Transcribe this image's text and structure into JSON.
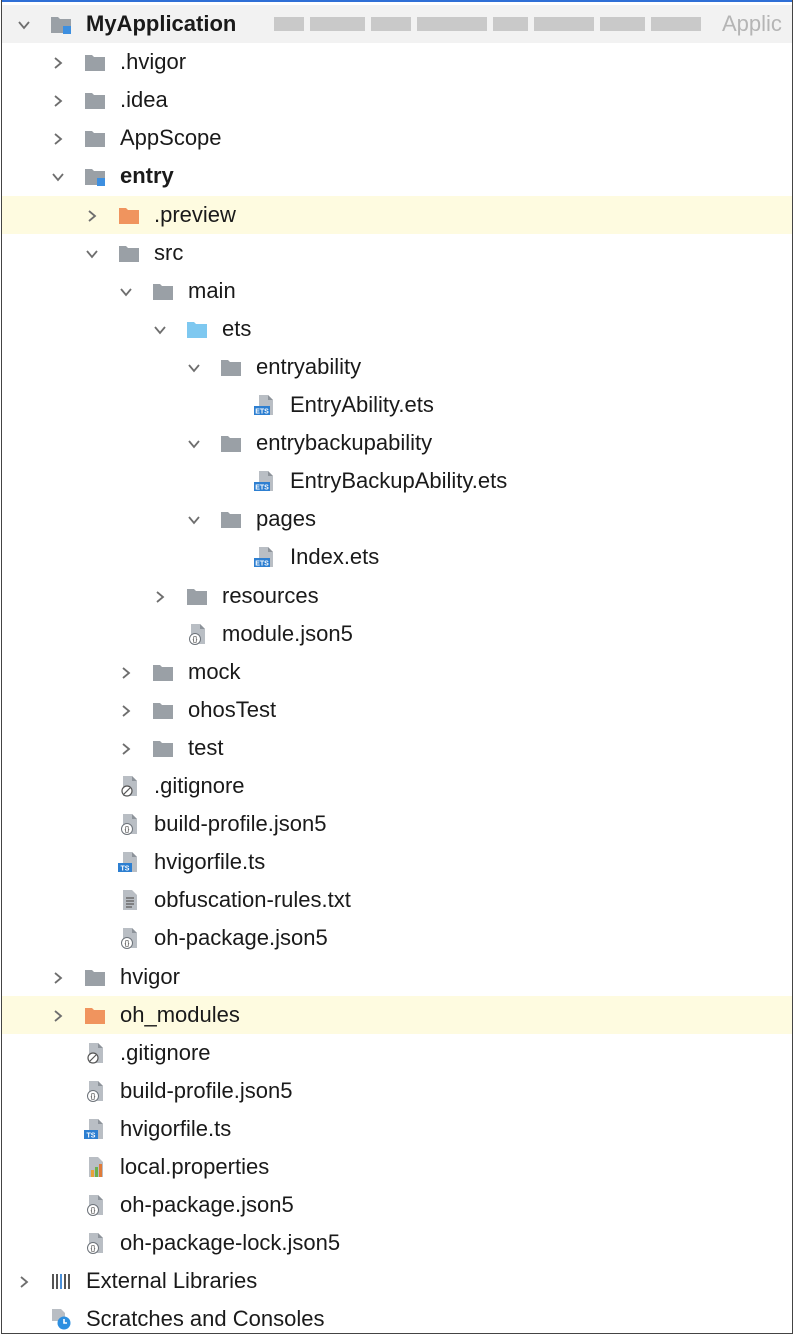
{
  "rows": [
    {
      "label": "MyApplication",
      "depth": 0,
      "chevron": "down",
      "icon": "module-folder",
      "bold": true,
      "root": true,
      "suffix": "Applic"
    },
    {
      "label": ".hvigor",
      "depth": 1,
      "chevron": "right",
      "icon": "folder"
    },
    {
      "label": ".idea",
      "depth": 1,
      "chevron": "right",
      "icon": "folder"
    },
    {
      "label": "AppScope",
      "depth": 1,
      "chevron": "right",
      "icon": "folder"
    },
    {
      "label": "entry",
      "depth": 1,
      "chevron": "down",
      "icon": "module-folder",
      "bold": true
    },
    {
      "label": ".preview",
      "depth": 2,
      "chevron": "right",
      "icon": "folder-orange",
      "highlight": true
    },
    {
      "label": "src",
      "depth": 2,
      "chevron": "down",
      "icon": "folder"
    },
    {
      "label": "main",
      "depth": 3,
      "chevron": "down",
      "icon": "folder"
    },
    {
      "label": "ets",
      "depth": 4,
      "chevron": "down",
      "icon": "folder-blue"
    },
    {
      "label": "entryability",
      "depth": 5,
      "chevron": "down",
      "icon": "folder"
    },
    {
      "label": "EntryAbility.ets",
      "depth": 6,
      "chevron": "none",
      "icon": "ets-file"
    },
    {
      "label": "entrybackupability",
      "depth": 5,
      "chevron": "down",
      "icon": "folder"
    },
    {
      "label": "EntryBackupAbility.ets",
      "depth": 6,
      "chevron": "none",
      "icon": "ets-file"
    },
    {
      "label": "pages",
      "depth": 5,
      "chevron": "down",
      "icon": "folder"
    },
    {
      "label": "Index.ets",
      "depth": 6,
      "chevron": "none",
      "icon": "ets-file"
    },
    {
      "label": "resources",
      "depth": 4,
      "chevron": "right",
      "icon": "folder"
    },
    {
      "label": "module.json5",
      "depth": 4,
      "chevron": "none",
      "icon": "json-file"
    },
    {
      "label": "mock",
      "depth": 3,
      "chevron": "right",
      "icon": "folder"
    },
    {
      "label": "ohosTest",
      "depth": 3,
      "chevron": "right",
      "icon": "folder"
    },
    {
      "label": "test",
      "depth": 3,
      "chevron": "right",
      "icon": "folder"
    },
    {
      "label": ".gitignore",
      "depth": 2,
      "chevron": "none",
      "icon": "ignore-file"
    },
    {
      "label": "build-profile.json5",
      "depth": 2,
      "chevron": "none",
      "icon": "json-file"
    },
    {
      "label": "hvigorfile.ts",
      "depth": 2,
      "chevron": "none",
      "icon": "ts-file"
    },
    {
      "label": "obfuscation-rules.txt",
      "depth": 2,
      "chevron": "none",
      "icon": "text-file"
    },
    {
      "label": "oh-package.json5",
      "depth": 2,
      "chevron": "none",
      "icon": "json-file"
    },
    {
      "label": "hvigor",
      "depth": 1,
      "chevron": "right",
      "icon": "folder"
    },
    {
      "label": "oh_modules",
      "depth": 1,
      "chevron": "right",
      "icon": "folder-orange",
      "highlight": true
    },
    {
      "label": ".gitignore",
      "depth": 1,
      "chevron": "none",
      "icon": "ignore-file"
    },
    {
      "label": "build-profile.json5",
      "depth": 1,
      "chevron": "none",
      "icon": "json-file"
    },
    {
      "label": "hvigorfile.ts",
      "depth": 1,
      "chevron": "none",
      "icon": "ts-file"
    },
    {
      "label": "local.properties",
      "depth": 1,
      "chevron": "none",
      "icon": "properties-file"
    },
    {
      "label": "oh-package.json5",
      "depth": 1,
      "chevron": "none",
      "icon": "json-file"
    },
    {
      "label": "oh-package-lock.json5",
      "depth": 1,
      "chevron": "none",
      "icon": "json-file"
    },
    {
      "label": "External Libraries",
      "depth": 0,
      "chevron": "right",
      "icon": "libraries"
    },
    {
      "label": "Scratches and Consoles",
      "depth": 0,
      "chevron": "none",
      "icon": "scratches"
    }
  ],
  "colors": {
    "folder": "#9aa0a6",
    "folder_orange": "#f0945e",
    "folder_blue": "#7ec8f0",
    "module_marker": "#3d8fe0",
    "file_badge": "#2d7fd1",
    "highlight": "#fefbe0",
    "chevron": "#6e6e6e"
  }
}
